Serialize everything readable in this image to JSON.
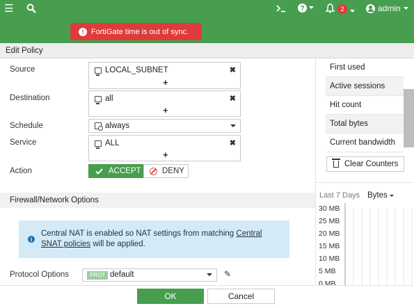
{
  "topbar": {
    "menu_icon": "hamburger-menu-icon",
    "search_icon": "search-icon",
    "cli_icon": "cli-console-icon",
    "help_icon": "help-icon",
    "notifications_icon": "bell-icon",
    "notification_count": "2",
    "user_label": "admin",
    "alert_text": "FortiGate time is out of sync.",
    "color_primary": "#469e4e",
    "color_alert": "#de3b3b"
  },
  "title": "Edit Policy",
  "form": {
    "source_label": "Source",
    "source_value": "LOCAL_SUBNET",
    "destination_label": "Destination",
    "destination_value": "all",
    "schedule_label": "Schedule",
    "schedule_value": "always",
    "service_label": "Service",
    "service_value": "ALL",
    "action_label": "Action",
    "accept_label": "ACCEPT",
    "deny_label": "DENY"
  },
  "section": {
    "title": "Firewall/Network Options",
    "info_text_prefix": "Central NAT is enabled so NAT settings from matching ",
    "info_link_1": "Central",
    "info_link_2": "SNAT policies",
    "info_text_suffix": " will be applied.",
    "protocol_options_label": "Protocol Options",
    "protocol_tag": "PROT",
    "protocol_value": "default"
  },
  "right_panel": {
    "columns": [
      "First used",
      "Active sessions",
      "Hit count",
      "Total bytes",
      "Current bandwidth"
    ],
    "clear_counters_label": "Clear Counters",
    "period_label": "Last 7 Days",
    "metric_label": "Bytes",
    "y_ticks": [
      "30 MB",
      "25 MB",
      "20 MB",
      "15 MB",
      "10 MB",
      "5 MB",
      "0 MB"
    ]
  },
  "footer": {
    "ok_label": "OK",
    "cancel_label": "Cancel"
  }
}
